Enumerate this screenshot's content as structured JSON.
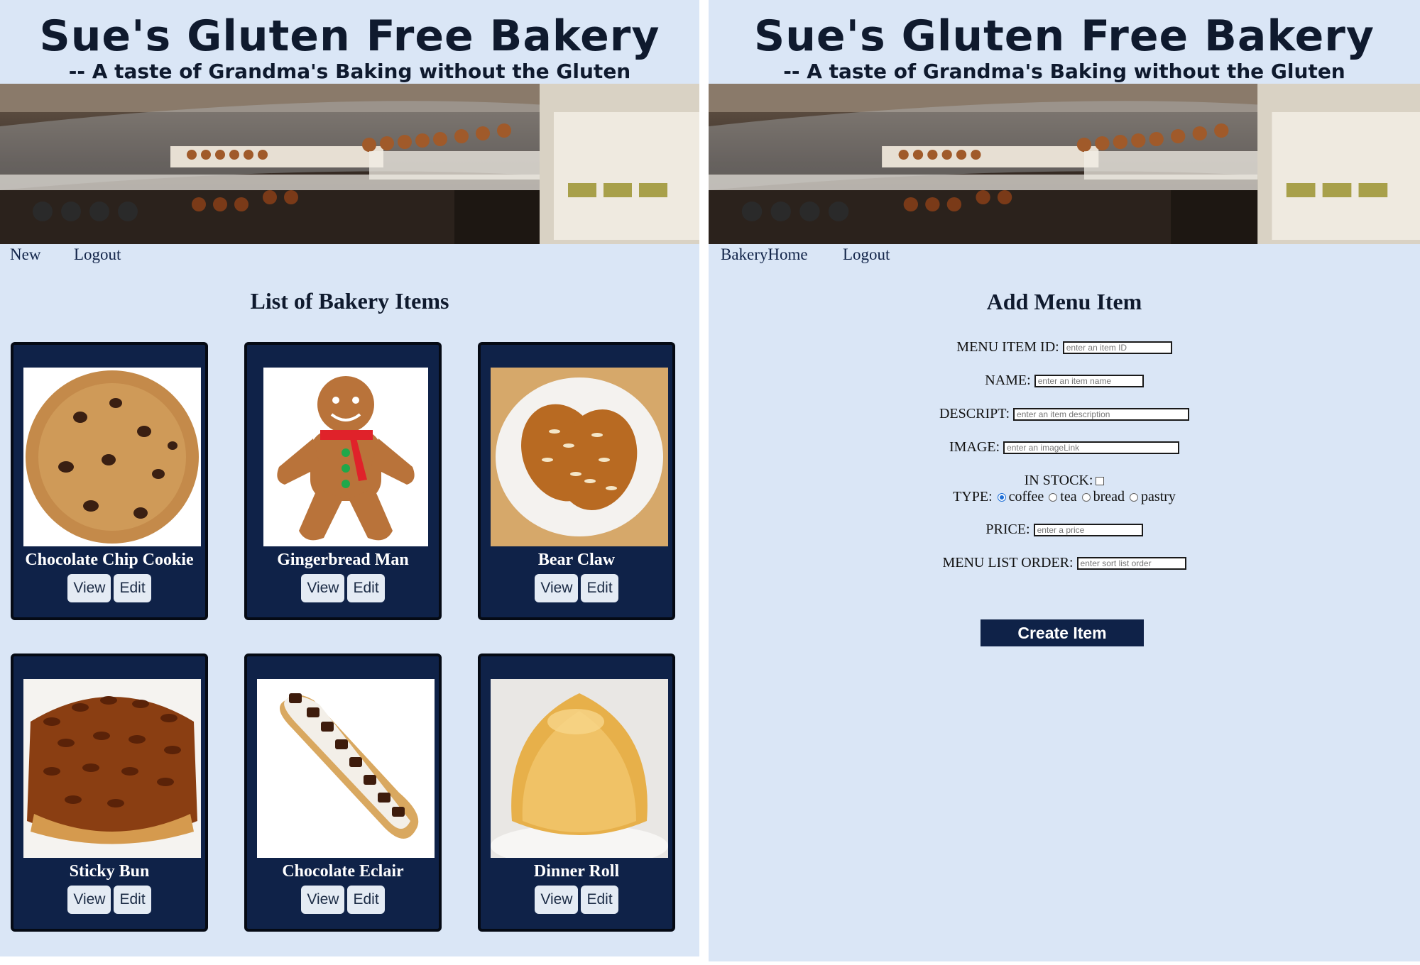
{
  "header": {
    "title": "Sue's Gluten Free Bakery",
    "subtitle": "-- A taste of Grandma's Baking without the Gluten"
  },
  "left": {
    "nav": {
      "new": "New",
      "logout": "Logout"
    },
    "heading": "List of Bakery Items",
    "items": [
      {
        "name": "Chocolate Chip Cookie",
        "view": "View",
        "edit": "Edit"
      },
      {
        "name": "Gingerbread Man",
        "view": "View",
        "edit": "Edit"
      },
      {
        "name": "Bear Claw",
        "view": "View",
        "edit": "Edit"
      },
      {
        "name": "Sticky Bun",
        "view": "View",
        "edit": "Edit"
      },
      {
        "name": "Chocolate Eclair",
        "view": "View",
        "edit": "Edit"
      },
      {
        "name": "Dinner Roll",
        "view": "View",
        "edit": "Edit"
      }
    ]
  },
  "right": {
    "nav": {
      "home": "BakeryHome",
      "logout": "Logout"
    },
    "heading": "Add Menu Item",
    "form": {
      "id_label": "MENU ITEM ID:",
      "id_placeholder": "enter an item ID",
      "name_label": "NAME:",
      "name_placeholder": "enter an item name",
      "desc_label": "DESCRIPT:",
      "desc_placeholder": "enter an item description",
      "image_label": "IMAGE:",
      "image_placeholder": "enter an imageLink",
      "stock_label": "IN STOCK:",
      "type_label": "TYPE:",
      "type_options": [
        "coffee",
        "tea",
        "bread",
        "pastry"
      ],
      "type_selected": "coffee",
      "price_label": "PRICE:",
      "price_placeholder": "enter a price",
      "order_label": "MENU LIST ORDER:",
      "order_placeholder": "enter sort list order",
      "submit": "Create Item"
    }
  },
  "colors": {
    "page_bg": "#dae6f6",
    "card_bg": "#0f2248",
    "heading": "#0f1a2e",
    "radio_selected": "#1f6fd6"
  }
}
